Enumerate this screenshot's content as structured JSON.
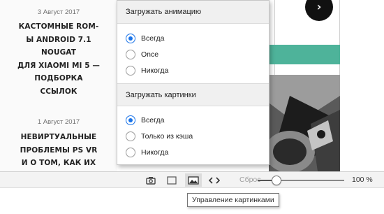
{
  "posts": [
    {
      "date": "3 Август 2017",
      "title_lines": [
        "Кастомные ROM-",
        "ы Android 7.1",
        "Nougat",
        "для Xiaomi Mi 5 —",
        "подборка",
        "ссылок"
      ]
    },
    {
      "date": "1 Август 2017",
      "title_lines": [
        "Невиртуальные",
        "проблемы PS VR",
        "и о том, как их"
      ]
    }
  ],
  "popup": {
    "animation": {
      "heading": "Загружать анимацию",
      "options": [
        "Всегда",
        "Once",
        "Никогда"
      ],
      "selected_index": 0
    },
    "images": {
      "heading": "Загружать картинки",
      "options": [
        "Всегда",
        "Только из кэша",
        "Никогда"
      ],
      "selected_index": 0
    }
  },
  "statusbar": {
    "zoom_label": "Сброс",
    "zoom_value": "100 %",
    "zoom_percent": 100,
    "buttons": [
      {
        "icon": "camera-icon",
        "active": false
      },
      {
        "icon": "window-icon",
        "active": false
      },
      {
        "icon": "image-icon",
        "active": true
      },
      {
        "icon": "code-icon",
        "active": false
      }
    ]
  },
  "content": {
    "next_glyph": "›"
  },
  "tooltip": {
    "text": "Управление картинками"
  },
  "colors": {
    "accent": "#1a73e8",
    "teal": "#4eb39a"
  }
}
